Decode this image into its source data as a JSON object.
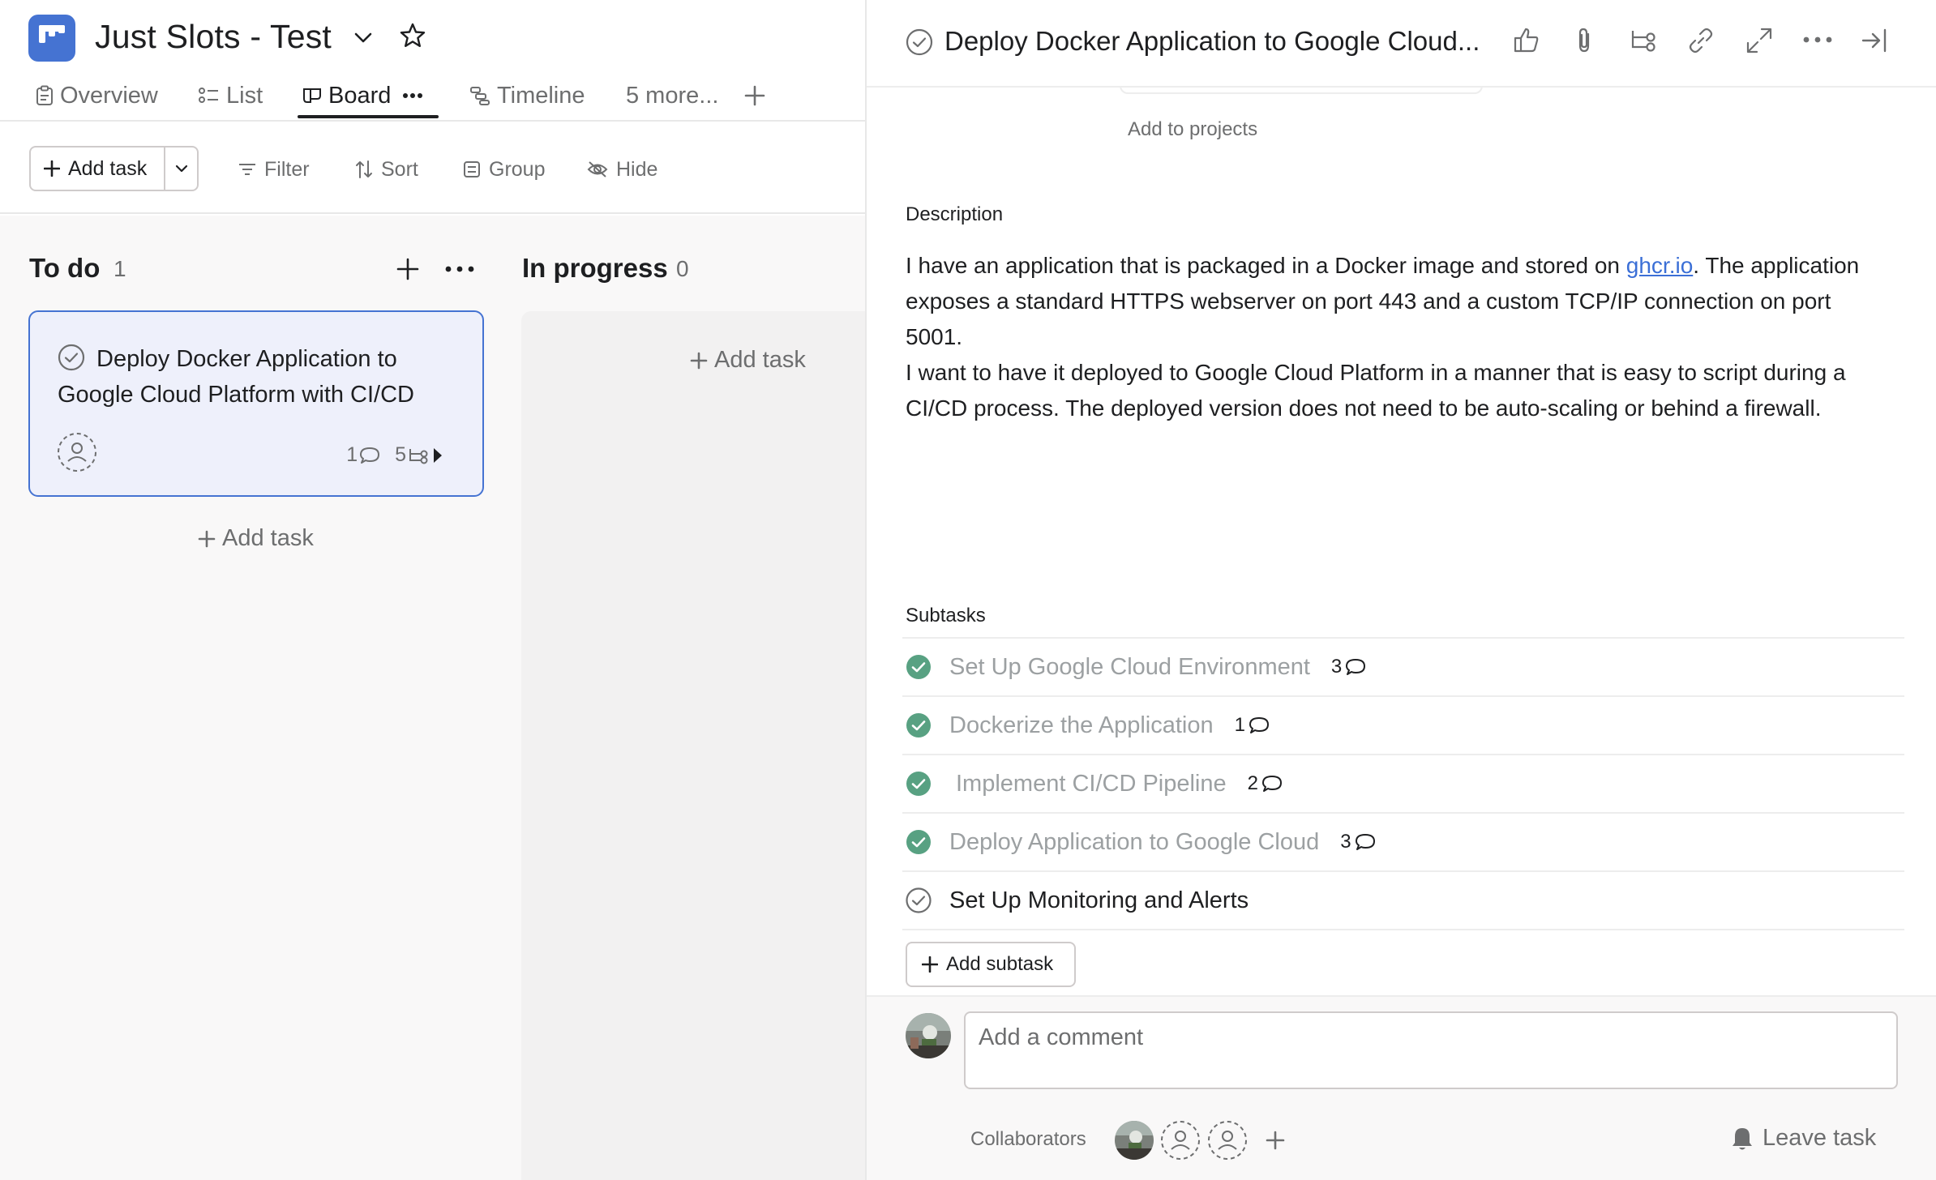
{
  "project": {
    "title": "Just Slots - Test",
    "icon": "board-logo-icon",
    "accent_color": "#4573d2"
  },
  "tabs": [
    {
      "label": "Overview",
      "icon": "clipboard-icon",
      "active": false
    },
    {
      "label": "List",
      "icon": "list-icon",
      "active": false
    },
    {
      "label": "Board",
      "icon": "board-icon",
      "active": true
    },
    {
      "label": "Timeline",
      "icon": "timeline-icon",
      "active": false
    },
    {
      "label": "5 more...",
      "icon": "",
      "active": false
    }
  ],
  "toolbar": {
    "add_task_label": "Add task",
    "filter_label": "Filter",
    "sort_label": "Sort",
    "group_label": "Group",
    "hide_label": "Hide"
  },
  "board": {
    "columns": [
      {
        "title": "To do",
        "count": "1",
        "cards": [
          {
            "title": "Deploy Docker Application to Google Cloud Platform with CI/CD",
            "comments": "1",
            "subtasks": "5"
          }
        ],
        "add_task_label": "Add task"
      },
      {
        "title": "In progress",
        "count": "0",
        "add_task_label": "Add task"
      }
    ]
  },
  "detail": {
    "title": "Deploy Docker Application to Google Cloud...",
    "add_to_projects": "Add to projects",
    "description_label": "Description",
    "description": {
      "part1": "I have an application that is packaged in a Docker image and stored on ",
      "link": "ghcr.io",
      "part2": ". The application exposes a standard HTTPS webserver on port 443 and a custom TCP/IP connection on port 5001.",
      "part3": "I want to have it deployed to Google Cloud Platform in a manner that is easy to script during a CI/CD process. The deployed version does not need to be auto-scaling or behind a firewall."
    },
    "subtasks_label": "Subtasks",
    "subtasks": [
      {
        "name": "Set Up Google Cloud Environment",
        "comments": "3",
        "done": true
      },
      {
        "name": "Dockerize the Application",
        "comments": "1",
        "done": true
      },
      {
        "name": "Implement CI/CD Pipeline",
        "comments": "2",
        "done": true
      },
      {
        "name": "Deploy Application to Google Cloud",
        "comments": "3",
        "done": true
      },
      {
        "name": "Set Up Monitoring and Alerts",
        "comments": "",
        "done": false
      }
    ],
    "add_subtask_label": "Add subtask",
    "comment_placeholder": "Add a comment",
    "collaborators_label": "Collaborators",
    "leave_task_label": "Leave task",
    "done_color": "#58a182"
  }
}
